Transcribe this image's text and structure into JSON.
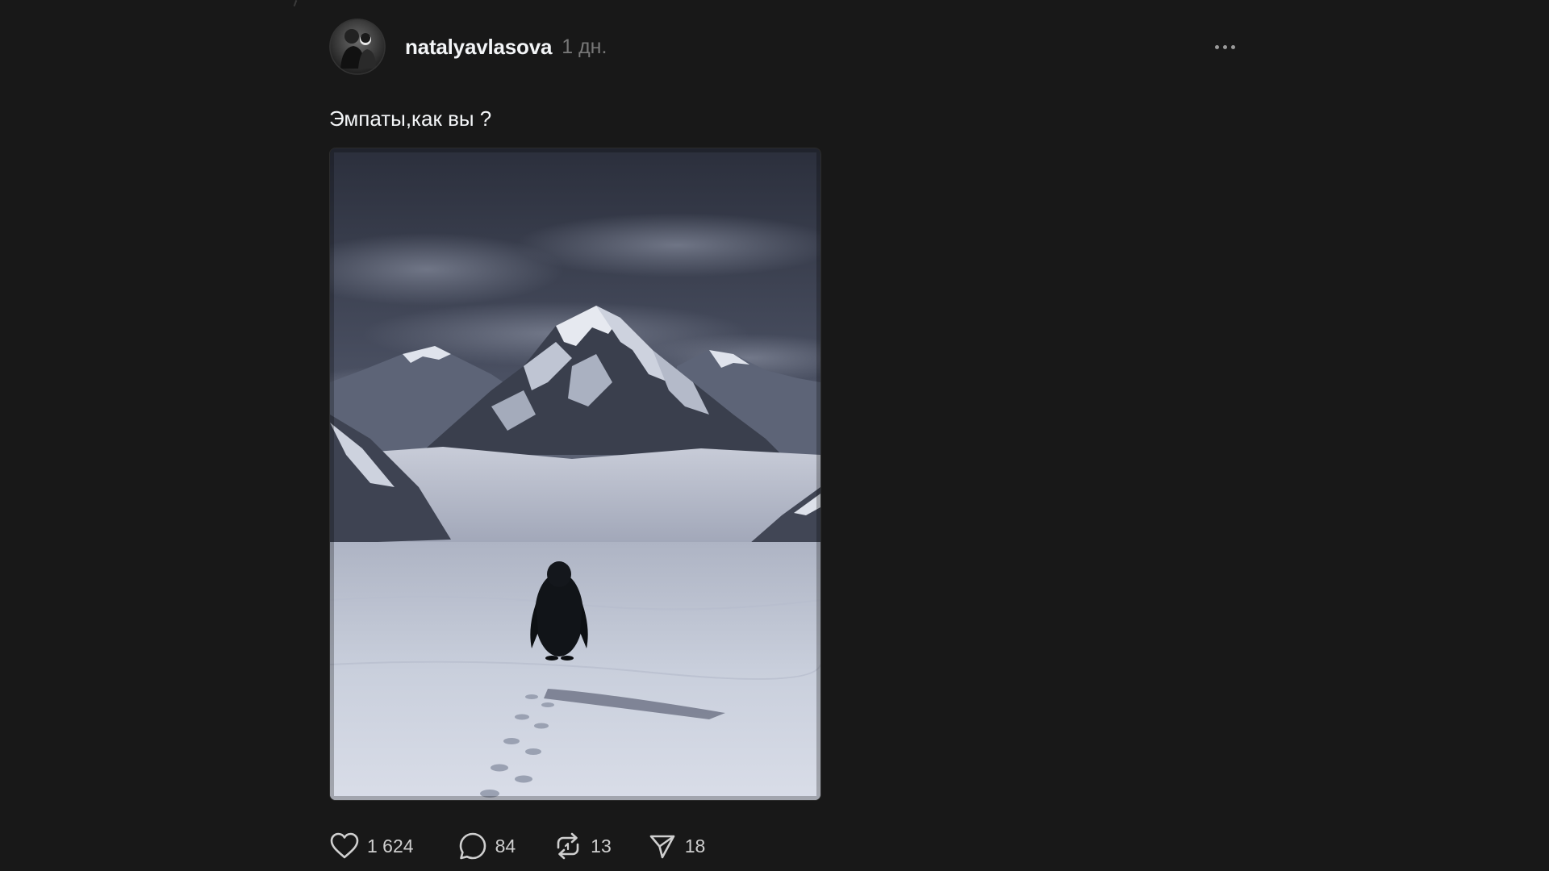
{
  "post": {
    "author": {
      "username": "natalyavlasova",
      "avatar_icon": "avatar-photo"
    },
    "timestamp": "1 дн.",
    "more_icon": "more-horizontal-icon",
    "caption": "Эмпаты,как вы ?",
    "media": {
      "kind": "photo",
      "scene": "penguin on snowfield facing mountains"
    },
    "actions": {
      "like": {
        "icon": "heart-icon",
        "count": "1 624"
      },
      "comment": {
        "icon": "comment-icon",
        "count": "84"
      },
      "repost": {
        "icon": "repost-icon",
        "count": "13"
      },
      "share": {
        "icon": "send-icon",
        "count": "18"
      }
    }
  },
  "colors": {
    "background": "#181818",
    "text_primary": "#f3f5f7",
    "text_secondary": "#777777",
    "icon": "#cfcfcf"
  }
}
